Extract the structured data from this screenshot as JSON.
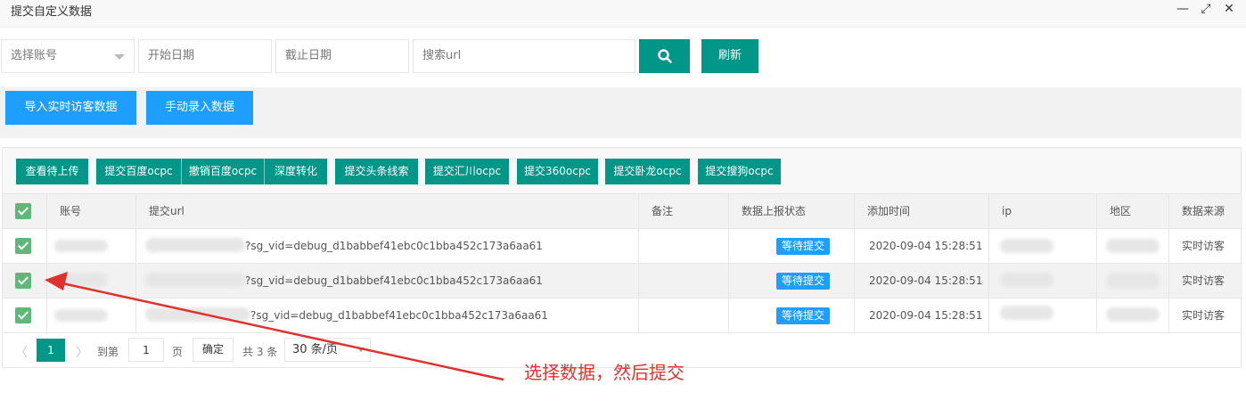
{
  "window": {
    "title": "提交自定义数据",
    "min": "—",
    "max": "⤢",
    "close": "✕"
  },
  "filters": {
    "account_placeholder": "选择账号",
    "start_placeholder": "开始日期",
    "end_placeholder": "截止日期",
    "url_placeholder": "搜索url",
    "refresh": "刷新"
  },
  "actions": {
    "import": "导入实时访客数据",
    "manual": "手动录入数据"
  },
  "toolbar": {
    "view_pending": "查看待上传",
    "submit_baidu": "提交百度ocpc",
    "revoke_baidu": "撤销百度ocpc",
    "deep": "深度转化",
    "toutiao": "提交头条线索",
    "huichuan": "提交汇川ocpc",
    "s360": "提交360ocpc",
    "wolong": "提交卧龙ocpc",
    "sogou": "提交搜狗ocpc"
  },
  "columns": [
    "账号",
    "提交url",
    "备注",
    "数据上报状态",
    "添加时间",
    "ip",
    "地区",
    "数据来源"
  ],
  "rows": [
    {
      "url": "?sg_vid=debug_d1babbef41ebc0c1bba452c173a6aa61",
      "note": "",
      "status": "等待提交",
      "time": "2020-09-04 15:28:51",
      "source": "实时访客"
    },
    {
      "url": "?sg_vid=debug_d1babbef41ebc0c1bba452c173a6aa61",
      "note": "",
      "status": "等待提交",
      "time": "2020-09-04 15:28:51",
      "source": "实时访客"
    },
    {
      "url": "?sg_vid=debug_d1babbef41ebc0c1bba452c173a6aa61",
      "note": "",
      "status": "等待提交",
      "time": "2020-09-04 15:28:51",
      "source": "实时访客"
    }
  ],
  "pager": {
    "current": "1",
    "goto_label": "到第",
    "goto_value": "1",
    "page_label": "页",
    "confirm": "确定",
    "total": "共 3 条",
    "per_page": "30 条/页"
  },
  "annotation": "选择数据，然后提交",
  "colors": {
    "teal": "#009688",
    "blue": "#1e9fff",
    "check": "#5fb878",
    "arrow": "#e0322d"
  }
}
